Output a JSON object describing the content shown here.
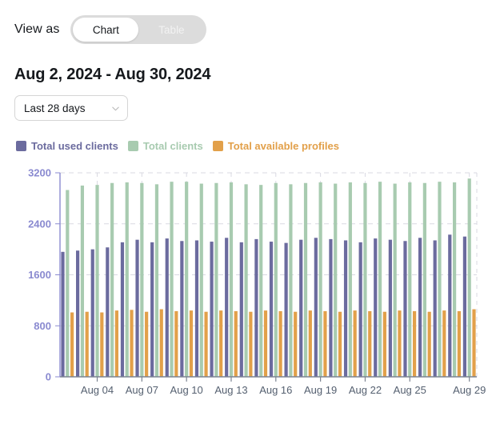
{
  "view_switch": {
    "label": "View as",
    "options": [
      "Chart",
      "Table"
    ],
    "selected": "Chart"
  },
  "date_heading": "Aug 2, 2024 - Aug 30, 2024",
  "range_select": {
    "value": "Last 28 days",
    "icon": "chevron-down-icon"
  },
  "legend": [
    {
      "label": "Total used clients",
      "color": "#6b6b9e"
    },
    {
      "label": "Total clients",
      "color": "#a8cbb0"
    },
    {
      "label": "Total available profiles",
      "color": "#e2a04a"
    }
  ],
  "chart_data": {
    "type": "bar",
    "title": "",
    "xlabel": "",
    "ylabel": "",
    "ylim": [
      0,
      3200
    ],
    "yticks": [
      0,
      800,
      1600,
      2400,
      3200
    ],
    "grid": true,
    "legend_position": "top-left",
    "categories": [
      "Aug 02",
      "Aug 03",
      "Aug 04",
      "Aug 05",
      "Aug 06",
      "Aug 07",
      "Aug 08",
      "Aug 09",
      "Aug 10",
      "Aug 11",
      "Aug 12",
      "Aug 13",
      "Aug 14",
      "Aug 15",
      "Aug 16",
      "Aug 17",
      "Aug 18",
      "Aug 19",
      "Aug 20",
      "Aug 21",
      "Aug 22",
      "Aug 23",
      "Aug 24",
      "Aug 25",
      "Aug 26",
      "Aug 27",
      "Aug 28",
      "Aug 29"
    ],
    "xtick_labels": [
      "Aug 04",
      "Aug 07",
      "Aug 10",
      "Aug 13",
      "Aug 16",
      "Aug 19",
      "Aug 22",
      "Aug 25",
      "Aug 29"
    ],
    "xtick_indices": [
      2,
      5,
      8,
      11,
      14,
      17,
      20,
      23,
      27
    ],
    "series": [
      {
        "name": "Total used clients",
        "color": "#6b6b9e",
        "values": [
          1960,
          1980,
          2000,
          2030,
          2110,
          2150,
          2110,
          2170,
          2130,
          2140,
          2120,
          2180,
          2110,
          2160,
          2120,
          2100,
          2150,
          2180,
          2160,
          2140,
          2110,
          2170,
          2150,
          2130,
          2180,
          2140,
          2230,
          2200
        ]
      },
      {
        "name": "Total clients",
        "color": "#a8cbb0",
        "values": [
          2930,
          3000,
          3010,
          3040,
          3050,
          3040,
          3020,
          3060,
          3060,
          3030,
          3040,
          3050,
          3020,
          3010,
          3040,
          3020,
          3040,
          3050,
          3030,
          3050,
          3040,
          3060,
          3030,
          3050,
          3040,
          3060,
          3050,
          3110
        ]
      },
      {
        "name": "Total available profiles",
        "color": "#e2a04a",
        "values": [
          1010,
          1020,
          1010,
          1040,
          1050,
          1020,
          1060,
          1030,
          1040,
          1020,
          1040,
          1030,
          1020,
          1040,
          1030,
          1020,
          1040,
          1030,
          1020,
          1040,
          1030,
          1020,
          1040,
          1030,
          1020,
          1040,
          1030,
          1060
        ]
      }
    ]
  }
}
